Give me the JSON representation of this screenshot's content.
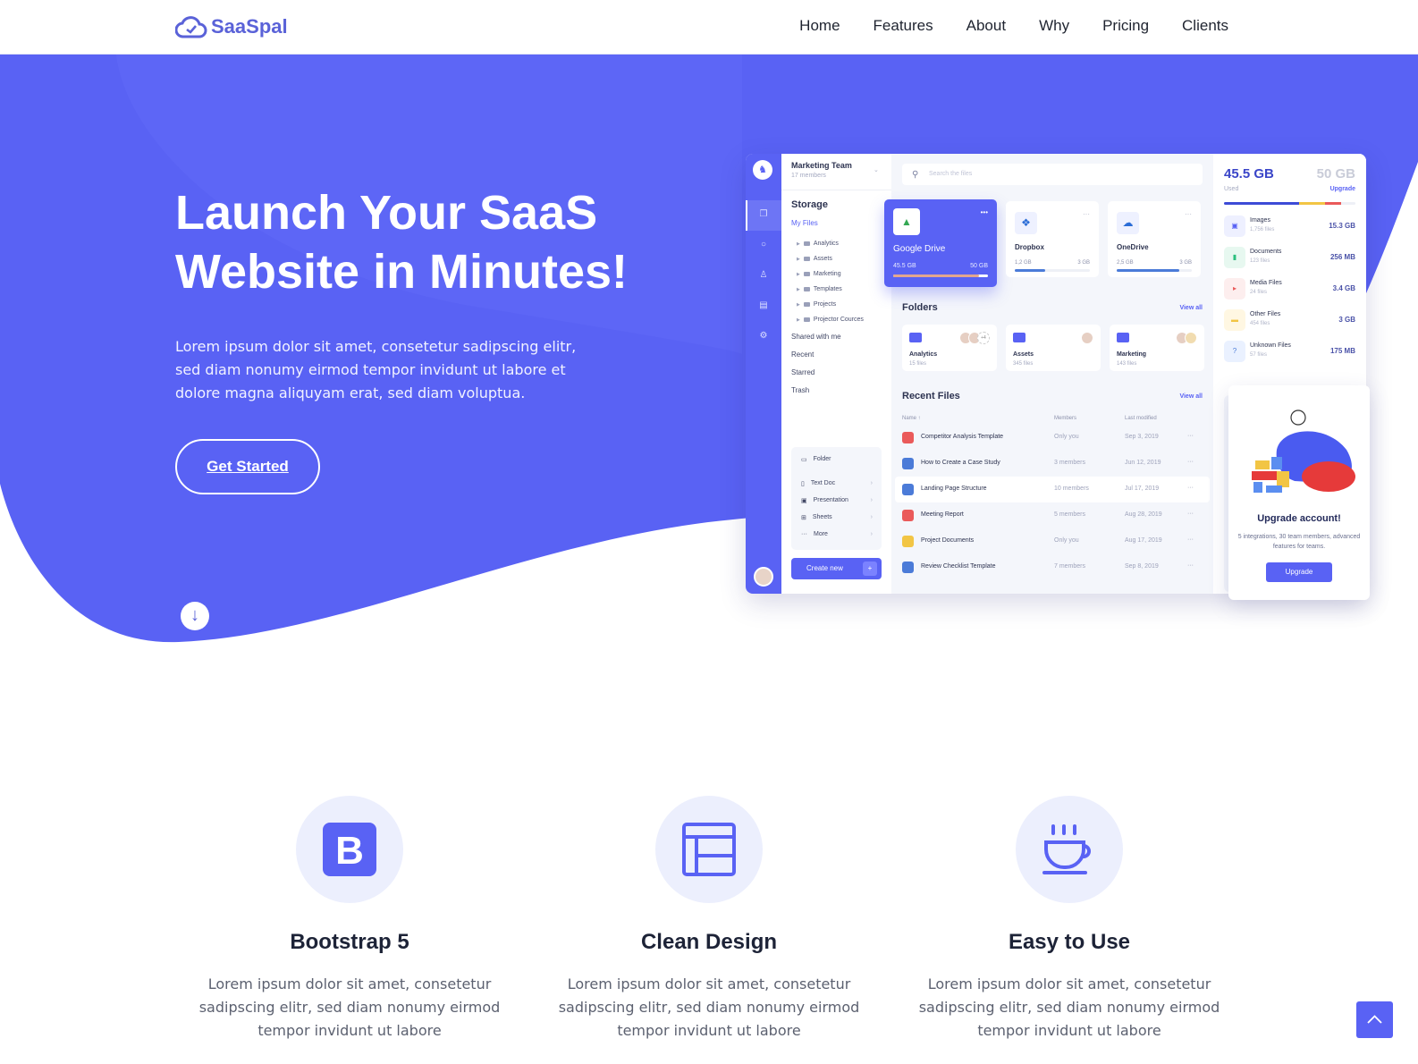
{
  "brand": {
    "name": "SaaSpal",
    "accent": "#5a62f4"
  },
  "nav": {
    "items": [
      "Home",
      "Features",
      "About",
      "Why",
      "Pricing",
      "Clients"
    ]
  },
  "hero": {
    "title": "Launch Your SaaS Website in Minutes!",
    "text": "Lorem ipsum dolor sit amet, consetetur sadipscing elitr, sed diam nonumy eirmod tempor invidunt ut labore et dolore magna aliquyam erat, sed diam voluptua.",
    "cta": "Get Started",
    "scroll_icon": "arrow-down-icon"
  },
  "dashboard": {
    "team": {
      "name": "Marketing Team",
      "members": "17 members"
    },
    "storage_title": "Storage",
    "my_files": "My Files",
    "tree": [
      "Analytics",
      "Assets",
      "Marketing",
      "Templates",
      "Projects",
      "Projector Cources"
    ],
    "links": [
      "Shared with me",
      "Recent",
      "Starred",
      "Trash"
    ],
    "new_menu": [
      "Folder",
      "Text Doc",
      "Presentation",
      "Sheets",
      "More"
    ],
    "create_new": "Create new",
    "search_placeholder": "Search the files",
    "clouds": [
      {
        "name": "Google Drive",
        "used": "45.5 GB",
        "total": "50 GB",
        "fill": 0.91
      },
      {
        "name": "Dropbox",
        "used": "1,2 GB",
        "total": "3 GB",
        "fill": 0.4
      },
      {
        "name": "OneDrive",
        "used": "2,5 GB",
        "total": "3 GB",
        "fill": 0.83
      }
    ],
    "folders_title": "Folders",
    "view_all": "View all",
    "folders": [
      {
        "name": "Analytics",
        "count": "15 files",
        "extra": "+4"
      },
      {
        "name": "Assets",
        "count": "345 files"
      },
      {
        "name": "Marketing",
        "count": "143 files"
      }
    ],
    "recent_title": "Recent Files",
    "columns": [
      "Name ↑",
      "Members",
      "Last modified"
    ],
    "files": [
      {
        "name": "Competitor Analysis Template",
        "members": "Only you",
        "date": "Sep 3, 2019",
        "type": "pdf"
      },
      {
        "name": "How to Create a Case Study",
        "members": "3 members",
        "date": "Jun 12, 2019",
        "type": "doc"
      },
      {
        "name": "Landing Page Structure",
        "members": "10 members",
        "date": "Jul 17, 2019",
        "type": "doc"
      },
      {
        "name": "Meeting Report",
        "members": "5 members",
        "date": "Aug 28, 2019",
        "type": "pdf"
      },
      {
        "name": "Project Documents",
        "members": "Only you",
        "date": "Aug 17, 2019",
        "type": "zip"
      },
      {
        "name": "Review Checklist Template",
        "members": "7 members",
        "date": "Sep 8, 2019",
        "type": "doc"
      }
    ],
    "usage": {
      "used": "45.5 GB",
      "total": "50 GB",
      "used_label": "Used",
      "upgrade": "Upgrade",
      "segments": [
        {
          "fill": 0.57,
          "color": "#3d4bd6"
        },
        {
          "fill": 0.2,
          "color": "#f2c544"
        },
        {
          "fill": 0.12,
          "color": "#ea5a5a"
        }
      ]
    },
    "types": [
      {
        "name": "Images",
        "count": "1,756 files",
        "size": "15.3 GB",
        "color": "#5962f4",
        "bg": "#eef0ff"
      },
      {
        "name": "Documents",
        "count": "123 files",
        "size": "256 MB",
        "color": "#2bbf7e",
        "bg": "#e7f8f0"
      },
      {
        "name": "Media Files",
        "count": "24 files",
        "size": "3.4 GB",
        "color": "#ea5a5a",
        "bg": "#fdeeee"
      },
      {
        "name": "Other Files",
        "count": "454 files",
        "size": "3 GB",
        "color": "#f2c544",
        "bg": "#fff7e2"
      },
      {
        "name": "Unknown Files",
        "count": "57 files",
        "size": "175 MB",
        "color": "#4b7bd8",
        "bg": "#eaf1ff"
      }
    ],
    "upgrade_card": {
      "title": "Upgrade account!",
      "text": "5 integrations, 30 team members, advanced features for teams.",
      "button": "Upgrade"
    }
  },
  "features": [
    {
      "title": "Bootstrap 5",
      "text": "Lorem ipsum dolor sit amet, consetetur sadipscing elitr, sed diam nonumy eirmod tempor invidunt ut labore",
      "icon": "bootstrap-icon"
    },
    {
      "title": "Clean Design",
      "text": "Lorem ipsum dolor sit amet, consetetur sadipscing elitr, sed diam nonumy eirmod tempor invidunt ut labore",
      "icon": "layout-icon"
    },
    {
      "title": "Easy to Use",
      "text": "Lorem ipsum dolor sit amet, consetetur sadipscing elitr, sed diam nonumy eirmod tempor invidunt ut labore",
      "icon": "coffee-icon"
    }
  ],
  "scroll_top_icon": "chevron-up-icon"
}
